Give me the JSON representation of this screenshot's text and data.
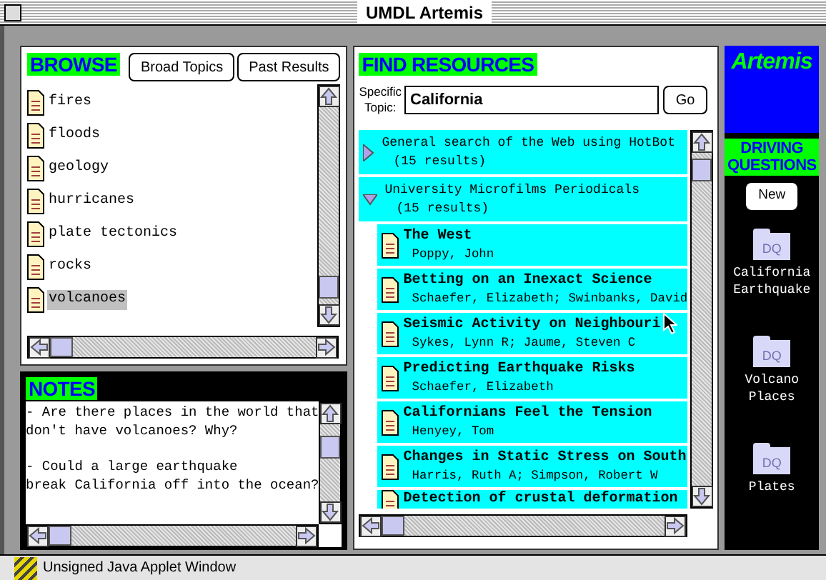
{
  "window": {
    "title": "UMDL Artemis"
  },
  "browse": {
    "title": "BROWSE",
    "buttons": [
      "Broad Topics",
      "Past Results"
    ],
    "items": [
      {
        "label": "fires",
        "selected": false
      },
      {
        "label": "floods",
        "selected": false
      },
      {
        "label": "geology",
        "selected": false
      },
      {
        "label": "hurricanes",
        "selected": false
      },
      {
        "label": "plate tectonics",
        "selected": false
      },
      {
        "label": "rocks",
        "selected": false
      },
      {
        "label": "volcanoes",
        "selected": true
      }
    ]
  },
  "notes": {
    "title": "NOTES",
    "paragraphs": [
      [
        "- Are there places in the world that",
        "don't have volcanoes? Why?"
      ],
      [
        "- Could a large earthquake",
        "break California off into the ocean?"
      ]
    ]
  },
  "find": {
    "title": "FIND RESOURCES",
    "topic_label": [
      "Specific",
      "Topic:"
    ],
    "topic_value": "California",
    "go": "Go",
    "groups": [
      {
        "title": "General search of the Web using HotBot",
        "count": "(15 results)",
        "expanded": false
      },
      {
        "title": "University Microfilms Periodicals",
        "count": "(15 results)",
        "expanded": true,
        "children": [
          {
            "title": "The West",
            "authors": "Poppy, John"
          },
          {
            "title": "Betting on an Inexact Science",
            "authors": "Schaefer, Elizabeth; Swinbanks, David"
          },
          {
            "title": "Seismic Activity on Neighbouri",
            "authors": "Sykes, Lynn R; Jaume, Steven C"
          },
          {
            "title": "Predicting Earthquake Risks",
            "authors": "Schaefer, Elizabeth"
          },
          {
            "title": "Californians Feel the Tension",
            "authors": "Henyey, Tom"
          },
          {
            "title": "Changes in Static Stress on South",
            "authors": "Harris, Ruth A; Simpson, Robert W"
          },
          {
            "title": "Detection of crustal deformation"
          }
        ]
      }
    ]
  },
  "driving": {
    "logo": "Artemis",
    "title": [
      "DRIVING",
      "QUESTIONS"
    ],
    "new_button": "New",
    "questions": [
      {
        "folder_text": "DQ",
        "label": [
          "California",
          "Earthquake"
        ]
      },
      {
        "folder_text": "DQ",
        "label": [
          "Volcano",
          "Places"
        ]
      },
      {
        "folder_text": "DQ",
        "label": [
          "Plates"
        ]
      }
    ]
  },
  "status_bar": "Unsigned Java Applet Window"
}
